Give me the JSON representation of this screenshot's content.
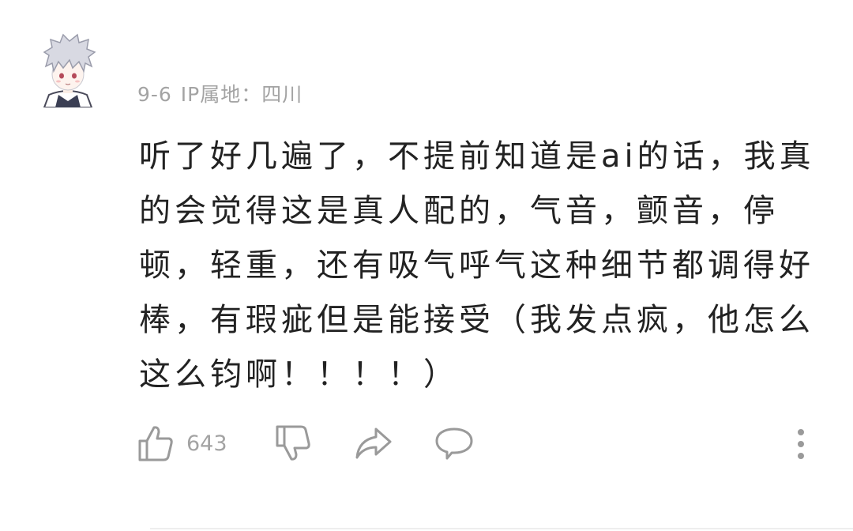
{
  "comment": {
    "date": "9-6",
    "ip_label": "IP属地：",
    "location": "四川",
    "text": "听了好几遍了，不提前知道是ai的话，我真的会觉得这是真人配的，气音，颤音，停顿，轻重，还有吸气呼气这种细节都调得好棒，有瑕疵但是能接受（我发点疯，他怎么这么钧啊！！！！）",
    "like_count": "643"
  },
  "icons": {
    "like": "thumbs-up-icon",
    "dislike": "thumbs-down-icon",
    "share": "share-arrow-icon",
    "reply": "speech-bubble-icon",
    "more": "vertical-ellipsis-icon"
  },
  "colors": {
    "text": "#222222",
    "meta": "#a3a3a3",
    "icon": "#9a9a9a",
    "background": "#ffffff"
  }
}
